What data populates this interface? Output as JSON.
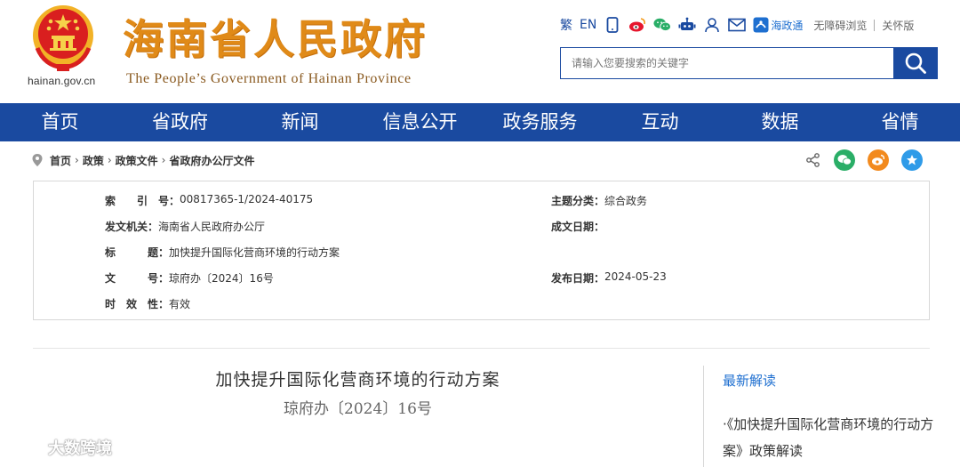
{
  "header": {
    "domain": "hainan.gov.cn",
    "title": "海南省人民政府",
    "subtitle": "The People’s Government  of Hainan Province",
    "toolbar": {
      "traditional": "繁",
      "english": "EN",
      "hnt_label": "海政通",
      "accessibility": "无障碍浏览",
      "elder": "关怀版"
    },
    "search": {
      "placeholder": "请输入您要搜索的关键字"
    }
  },
  "nav": [
    "首页",
    "省政府",
    "新闻",
    "信息公开",
    "政务服务",
    "互动",
    "数据",
    "省情"
  ],
  "breadcrumb": [
    "首页",
    "政策",
    "政策文件",
    "省政府办公厅文件"
  ],
  "info": {
    "index_label": "索　　引　号：",
    "index_value": "00817365-1/2024-40175",
    "topic_label": "主题分类：",
    "topic_value": "综合政务",
    "issuer_label": "发文机关：",
    "issuer_value": "海南省人民政府办公厅",
    "written_label": "成文日期：",
    "written_value": "",
    "title_label": "标　　　题：",
    "title_value": "加快提升国际化营商环境的行动方案",
    "docno_label": "文　　　号：",
    "docno_value": "琼府办〔2024〕16号",
    "published_label": "发布日期：",
    "published_value": "2024-05-23",
    "validity_label": "时　效　性：",
    "validity_value": "有效"
  },
  "document": {
    "title": "加快提升国际化营商环境的行动方案",
    "number": "琼府办〔2024〕16号"
  },
  "sidebar": {
    "title": "最新解读",
    "items": [
      "·《加快提升国际化营商环境的行动方案》政策解读"
    ]
  },
  "watermark": "大数跨境",
  "colors": {
    "brand_blue": "#1a4aa0",
    "title_orange": "#e08a18",
    "link_blue": "#1e6fd0"
  }
}
